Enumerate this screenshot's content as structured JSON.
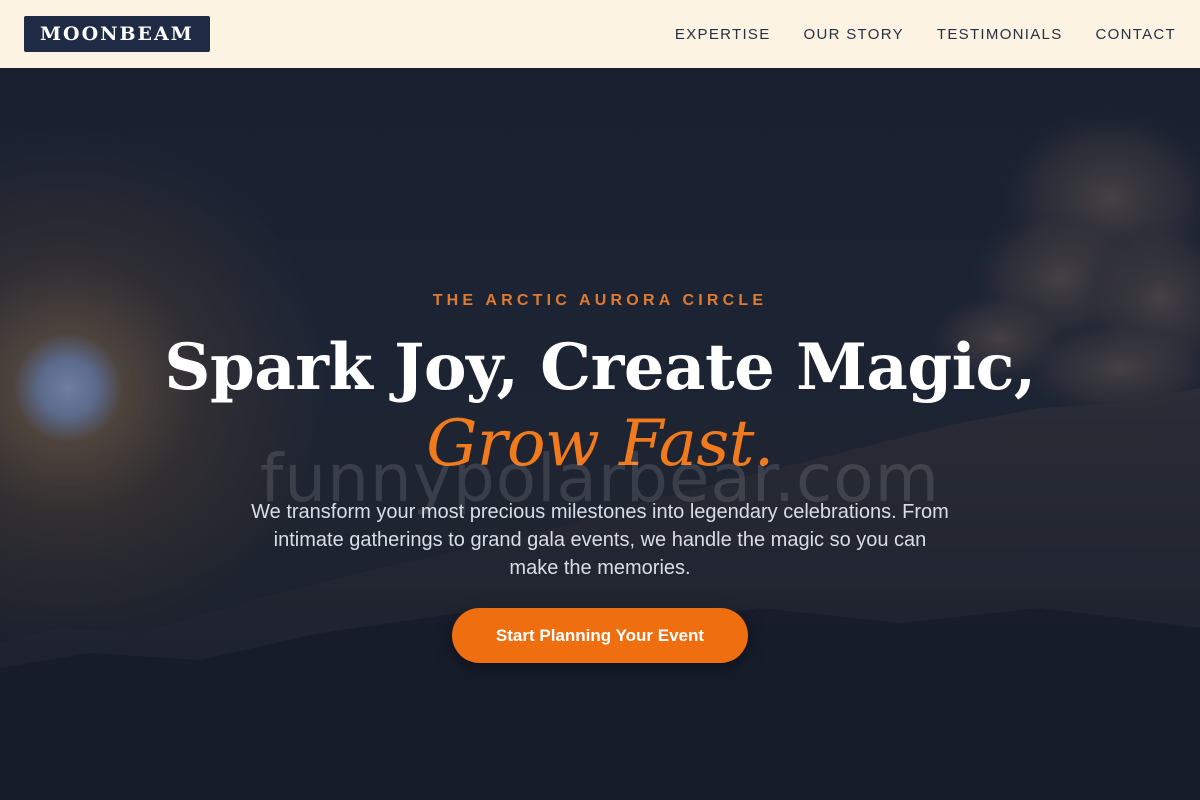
{
  "header": {
    "logo_text": "MOONBEAM",
    "nav": [
      {
        "label": "EXPERTISE"
      },
      {
        "label": "OUR STORY"
      },
      {
        "label": "TESTIMONIALS"
      },
      {
        "label": "CONTACT"
      }
    ]
  },
  "hero": {
    "eyebrow": "THE ARCTIC AURORA CIRCLE",
    "headline_line1": "Spark Joy, Create Magic,",
    "headline_line2": "Grow Fast.",
    "watermark": "funnypolarbear.com",
    "description": "We transform your most precious milestones into legendary celebrations. From intimate gatherings to grand gala events, we handle the magic so you can make the memories.",
    "cta_label": "Start Planning Your Event"
  },
  "colors": {
    "header_bg": "#fdf3e2",
    "logo_bg": "#1f2a44",
    "accent": "#f07a1c",
    "hero_bg": "#1d2536"
  }
}
